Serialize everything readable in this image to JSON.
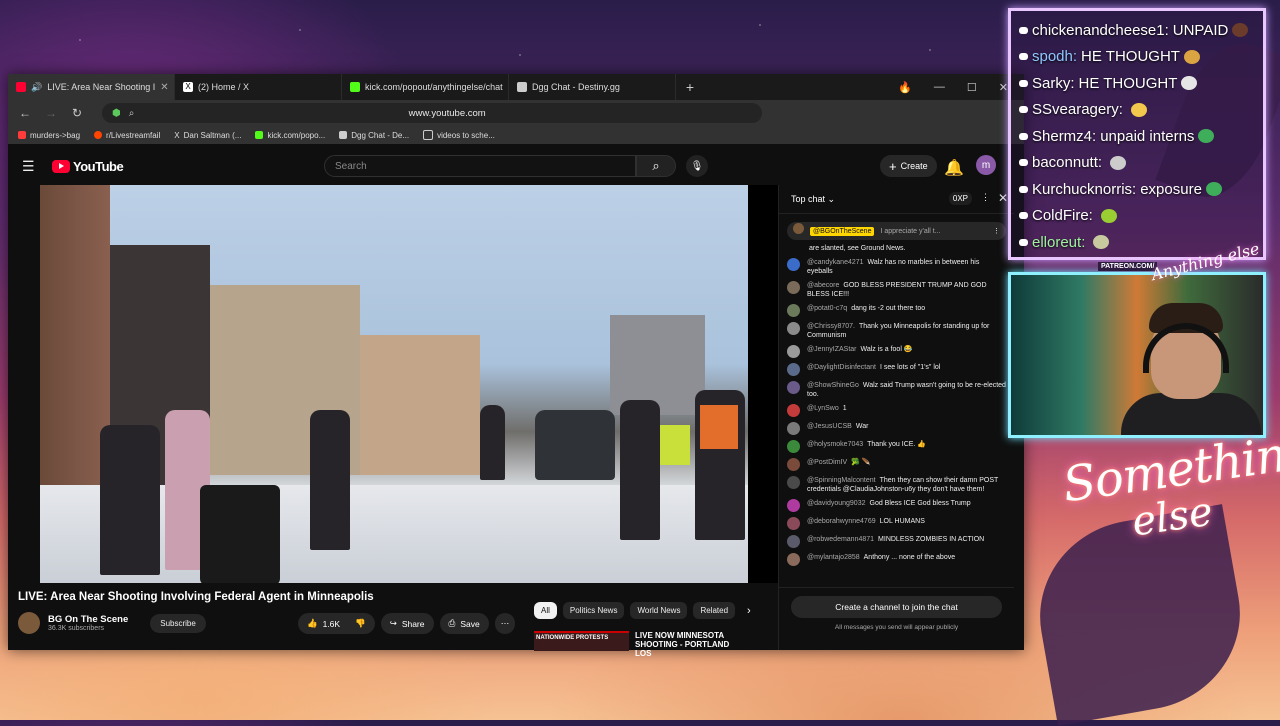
{
  "browser": {
    "tabs": [
      {
        "label": "LIVE: Area Near Shooting I",
        "color": "#ff0033",
        "active": true
      },
      {
        "label": "(2) Home / X",
        "color": "#000000",
        "active": false
      },
      {
        "label": "kick.com/popout/anythingelse/chat",
        "color": "#53fc18",
        "active": false
      },
      {
        "label": "Dgg Chat - Destiny.gg",
        "color": "#cccccc",
        "active": false
      }
    ],
    "new_tab": "+",
    "url": "www.youtube.com",
    "bookmarks": [
      {
        "label": "murders->bag",
        "color": "#ff3b3b"
      },
      {
        "label": "r/Livestreamfail",
        "color": "#ff4500"
      },
      {
        "label": "Dan Saltman (...",
        "color": "#000000"
      },
      {
        "label": "kick.com/popo...",
        "color": "#53fc18"
      },
      {
        "label": "Dgg Chat - De...",
        "color": "#cccccc"
      },
      {
        "label": "videos to sche...",
        "color": "#888888"
      }
    ]
  },
  "youtube": {
    "logo": "YouTube",
    "search_placeholder": "Search",
    "create_label": "Create",
    "avatar_letter": "m",
    "video_title": "LIVE: Area Near Shooting Involving Federal Agent in Minneapolis",
    "channel_name": "BG On The Scene",
    "subscribers": "36.3K subscribers",
    "subscribe_label": "Subscribe",
    "likes": "1.6K",
    "share_label": "Share",
    "save_label": "Save",
    "chips": [
      "All",
      "Politics News",
      "World News",
      "Related"
    ],
    "next_thumb_text": "NATIONWIDE PROTESTS",
    "next_video_title": "LIVE NOW MINNESOTA SHOOTING - PORTLAND LOS"
  },
  "live_chat": {
    "mode": "Top chat",
    "xp": "0XP",
    "pinned_author": "@BGOnTheScene",
    "pinned_text": "I appreciate y'all t...",
    "cut_text": "are slanted, see Ground News.",
    "messages": [
      {
        "author": "@candykane4271",
        "text": "Walz has no marbles in between his eyeballs",
        "color": "#3b6cc9"
      },
      {
        "author": "@abecore",
        "text": "GOD BLESS PRESIDENT TRUMP AND GOD BLESS ICE!!!",
        "color": "#7a6a5a"
      },
      {
        "author": "@potat0-c7q",
        "text": "dang its -2 out there too",
        "color": "#6a7a5a"
      },
      {
        "author": "@Chrissy8707.",
        "text": "Thank you Minneapolis for standing up for Communism",
        "color": "#8a8a8a"
      },
      {
        "author": "@JennyIZAStar",
        "text": "Walz is a fool 😂",
        "color": "#9a9a9a"
      },
      {
        "author": "@DaylightDisinfectant",
        "text": "I see lots of \"1's\" lol",
        "color": "#5a6a8a"
      },
      {
        "author": "@ShowShineGo",
        "text": "Walz said Trump wasn't going to be re-elected too.",
        "color": "#6a5a8a"
      },
      {
        "author": "@LynSwo",
        "text": "1",
        "color": "#c43b3b"
      },
      {
        "author": "@JesusUCSB",
        "text": "War",
        "color": "#7a7a7a"
      },
      {
        "author": "@holysmoke7043",
        "text": "Thank you ICE. 👍",
        "color": "#3b8a3b"
      },
      {
        "author": "@PostDimIV",
        "text": "🥦 🪶",
        "color": "#7a4a3a"
      },
      {
        "author": "@SpinningMalcontent",
        "text": "Then they can show their damn POST credentials @ClaudiaJohnston-u6y they don't have them!",
        "color": "#4a4a4a"
      },
      {
        "author": "@davidyoung9032",
        "text": "God Bless ICE God bless Trump",
        "color": "#b03ba0"
      },
      {
        "author": "@deborahwynne4769",
        "text": "LOL HUMANS",
        "color": "#8a4a5a"
      },
      {
        "author": "@robwedemann4871",
        "text": "MINDLESS ZOMBIES IN ACTION",
        "color": "#5a5a6a"
      },
      {
        "author": "@mylantajo2858",
        "text": "Anthony ... none of the above",
        "color": "#8a6a5a"
      }
    ],
    "join_label": "Create a channel to join the chat",
    "notice": "All messages you send will appear publicly"
  },
  "overlay_chat": {
    "lines": [
      {
        "user": "chickenandcheese1:",
        "text": " UNPAID",
        "style": "white"
      },
      {
        "user": "spodh:",
        "text": " HE THOUGHT",
        "style": "blue"
      },
      {
        "user": "Sarky:",
        "text": " HE THOUGHT",
        "style": "white"
      },
      {
        "user": "SSvearagery:",
        "text": "",
        "style": "white"
      },
      {
        "user": "Shermz4:",
        "text": " unpaid interns",
        "style": "white"
      },
      {
        "user": "baconnutt:",
        "text": "",
        "style": "white"
      },
      {
        "user": "Kurchucknorris:",
        "text": " exposure",
        "style": "white"
      },
      {
        "user": "ColdFire:",
        "text": "",
        "style": "white"
      },
      {
        "user": "elloreut:",
        "text": "",
        "style": "green"
      }
    ]
  },
  "stream_branding": {
    "patreon": "PATREON.COM/",
    "signature": "Anything else",
    "title_line1": "Something",
    "title_line2": "else"
  }
}
